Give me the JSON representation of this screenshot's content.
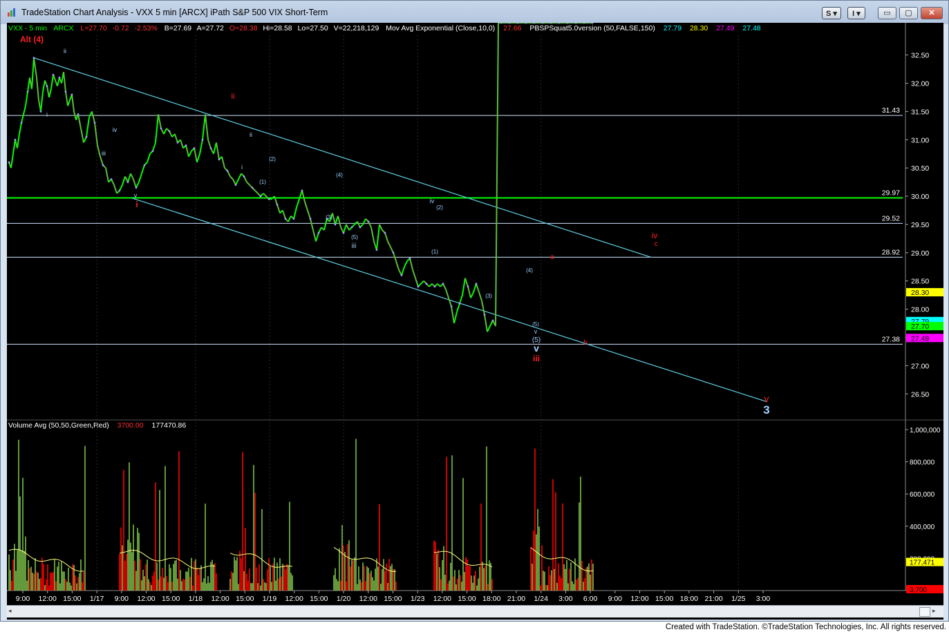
{
  "window": {
    "title": "TradeStation Chart Analysis - VXX 5 min [ARCX] iPath S&P 500 VIX Short-Term",
    "buttons": {
      "s_label": "S",
      "i_label": "I",
      "min": "▭",
      "max": "▢",
      "close": "✕"
    }
  },
  "header": {
    "symbol": "VXX - 5 min",
    "exchange": "ARCX",
    "last": "L=27.70",
    "change": "-0.72",
    "pct": "-2.53%",
    "bid": "B=27.69",
    "ask": "A=27.72",
    "open": "O=28.38",
    "hi": "Hi=28.58",
    "lo": "Lo=27.50",
    "vol": "V=22,218,129",
    "ma_label": "Mov Avg Exponential (Close,10,0)",
    "ma_val": "27.66",
    "pbs_label": "PBSPSquat5.0version (50,FALSE,150)",
    "pbs_v1": "27.79",
    "pbs_v2": "28.30",
    "pbs_v3": "27.49",
    "pbs_v4": "27.48"
  },
  "volume_header": {
    "label": "Volume Avg (50,50,Green,Red)",
    "v1": "3700.00",
    "v2": "177470.86"
  },
  "footer_text": "Created with TradeStation. ©TradeStation Technologies, Inc. All rights reserved.",
  "colors": {
    "up": "#00ff00",
    "down": "#ff0000",
    "channel": "#5fd3e6",
    "hline": "#cfe6ff",
    "green_line": "#00ff00",
    "wave_red": "#ff2020",
    "wave_blue": "#9fd3ff",
    "yellow_avg": "#ffff80"
  },
  "chart_data": [
    {
      "type": "line",
      "name_label": "VXX 5 min price (approximate path)",
      "x_ticks": [
        "9:00",
        "12:00",
        "15:00",
        "1/17",
        "9:00",
        "12:00",
        "15:00",
        "1/18",
        "12:00",
        "15:00",
        "1/19",
        "12:00",
        "15:00",
        "1/20",
        "12:00",
        "15:00",
        "1/23",
        "12:00",
        "15:00",
        "18:00",
        "21:00",
        "1/24",
        "3:00",
        "6:00",
        "9:00",
        "12:00",
        "15:00",
        "18:00",
        "21:00",
        "1/25",
        "3:00"
      ],
      "y_ticks": [
        "32.50",
        "32.00",
        "31.50",
        "31.00",
        "30.50",
        "30.00",
        "29.50",
        "29.00",
        "28.50",
        "28.00",
        "27.50",
        "27.00",
        "26.50"
      ],
      "ylim": [
        26.1,
        32.85
      ],
      "series_x": [
        0,
        3,
        6,
        9,
        12,
        15,
        18,
        21,
        24,
        27,
        30,
        33,
        36,
        40,
        43,
        46,
        49,
        52,
        55,
        58,
        61,
        64,
        67,
        70,
        73,
        76,
        79,
        82,
        85,
        88,
        91,
        94,
        97,
        100,
        104,
        108,
        112,
        116,
        120,
        124,
        128,
        132,
        136,
        140,
        144,
        148,
        152,
        156,
        160,
        164,
        168,
        172,
        176,
        180,
        184,
        188,
        192,
        196,
        200,
        204,
        208,
        212,
        216,
        220,
        224,
        228,
        232,
        236,
        240,
        244,
        248,
        252,
        256,
        260,
        264,
        268,
        272,
        276,
        280,
        284,
        288,
        292,
        296,
        300,
        304,
        308,
        312,
        316,
        320,
        324,
        328,
        332,
        336,
        340,
        344,
        348,
        352,
        356,
        360,
        364,
        368,
        372,
        376,
        380,
        384,
        388,
        392,
        396,
        400,
        404,
        408,
        412,
        416,
        420,
        424,
        428,
        432,
        436,
        440,
        444,
        448,
        452,
        456,
        460,
        464,
        468,
        472,
        476,
        480,
        484,
        488,
        492,
        496,
        500,
        504,
        508,
        512,
        516,
        520,
        524,
        528,
        532,
        536,
        540,
        544,
        548,
        552,
        556,
        560,
        564,
        568,
        572,
        576,
        580,
        584,
        588,
        592,
        596,
        600,
        604,
        608,
        612,
        616,
        620,
        624,
        628,
        632,
        636,
        640,
        644,
        648,
        652,
        656,
        660,
        664,
        668,
        672,
        676,
        680,
        684,
        688,
        692,
        696,
        700,
        704,
        708,
        712,
        716,
        720,
        724,
        728,
        732,
        736,
        740,
        744,
        748,
        752,
        756,
        760,
        764,
        768,
        772,
        776,
        780,
        784,
        788,
        792,
        796,
        800,
        804,
        808,
        812,
        816,
        820,
        824,
        828,
        832,
        836,
        840,
        844
      ],
      "series_y": [
        30.6,
        30.5,
        30.75,
        31.0,
        30.85,
        31.1,
        31.3,
        31.45,
        31.6,
        31.85,
        32.1,
        31.9,
        32.45,
        32.1,
        31.7,
        31.5,
        31.85,
        32.05,
        31.95,
        31.75,
        31.9,
        32.15,
        32.05,
        31.95,
        32.1,
        32.0,
        32.2,
        31.85,
        31.6,
        31.7,
        31.8,
        31.5,
        31.35,
        31.45,
        31.2,
        30.95,
        31.05,
        31.4,
        31.5,
        31.3,
        30.9,
        30.7,
        30.55,
        30.5,
        30.25,
        30.3,
        30.2,
        30.05,
        30.1,
        30.2,
        30.35,
        30.25,
        30.4,
        30.3,
        30.15,
        30.25,
        30.4,
        30.55,
        30.6,
        30.75,
        30.8,
        30.95,
        31.45,
        31.2,
        31.1,
        31.2,
        31.15,
        31.05,
        31.1,
        30.95,
        31.0,
        30.85,
        30.9,
        30.7,
        30.8,
        30.85,
        30.6,
        30.75,
        31.0,
        31.45,
        31.0,
        30.85,
        30.75,
        30.95,
        30.65,
        30.7,
        30.5,
        30.45,
        30.35,
        30.3,
        30.2,
        30.3,
        30.4,
        30.35,
        30.25,
        30.2,
        30.15,
        30.1,
        30.05,
        30.0,
        30.05,
        30.0,
        29.95,
        29.95,
        30.0,
        29.85,
        29.7,
        29.75,
        29.6,
        29.55,
        29.65,
        29.6,
        29.8,
        29.95,
        30.1,
        29.9,
        29.75,
        29.6,
        29.4,
        29.2,
        29.35,
        29.45,
        29.4,
        29.6,
        29.55,
        29.7,
        29.5,
        29.65,
        29.45,
        29.35,
        29.5,
        29.4,
        29.45,
        29.5,
        29.55,
        29.45,
        29.5,
        29.6,
        29.55,
        29.45,
        29.2,
        29.05,
        29.5,
        29.4,
        29.35,
        29.2,
        29.1,
        29.0,
        28.85,
        28.7,
        28.6,
        28.75,
        28.85,
        28.9,
        28.7,
        28.55,
        28.4,
        28.45,
        28.5,
        28.45,
        28.4,
        28.45,
        28.4,
        28.45,
        28.4,
        28.45,
        28.35,
        28.2,
        28.05,
        27.75,
        27.95,
        28.1,
        28.25,
        28.55,
        28.4,
        28.2,
        28.3,
        28.45,
        28.3,
        28.15,
        27.9,
        27.6,
        27.7,
        27.8,
        27.7
      ]
    },
    {
      "type": "bar",
      "name_label": "Volume",
      "y_ticks": [
        "1,000,000",
        "800,000",
        "600,000",
        "400,000",
        "200,000"
      ],
      "ylim": [
        0,
        1030000
      ],
      "markers": [
        {
          "label": "177,471",
          "value": 177471
        },
        {
          "label": "3,700",
          "value": 3700
        }
      ]
    }
  ],
  "levels": [
    {
      "label": "31.43",
      "value": 31.43
    },
    {
      "label": "29.97",
      "value": 29.97,
      "green": true
    },
    {
      "label": "29.52",
      "value": 29.52
    },
    {
      "label": "28.92",
      "value": 28.92
    },
    {
      "label": "27.38",
      "value": 27.38
    }
  ],
  "axis_markers": [
    {
      "label": "28.30",
      "value": 28.3,
      "bg": "#ffff00",
      "fg": "#000"
    },
    {
      "label": "27.79",
      "value": 27.79,
      "bg": "#00ffff",
      "fg": "#000"
    },
    {
      "label": "27.70",
      "value": 27.7,
      "bg": "#00ff00",
      "fg": "#000"
    },
    {
      "label": "27.49",
      "value": 27.49,
      "bg": "#ff00ff",
      "fg": "#000"
    }
  ],
  "wave_labels": [
    {
      "t": "Alt (4)",
      "c": "red",
      "s": 12,
      "b": true
    },
    {
      "t": "ii",
      "c": "blue",
      "s": 9
    },
    {
      "t": "i",
      "c": "blue",
      "s": 9
    },
    {
      "t": "iii",
      "c": "blue",
      "s": 9
    },
    {
      "t": "iv",
      "c": "blue",
      "s": 9
    },
    {
      "t": "v",
      "c": "blue",
      "s": 9
    },
    {
      "t": "i",
      "c": "red",
      "s": 12,
      "b": true
    },
    {
      "t": "ii",
      "c": "red",
      "s": 12
    },
    {
      "t": "ii",
      "c": "blue",
      "s": 9
    },
    {
      "t": "i",
      "c": "blue",
      "s": 9
    },
    {
      "t": "(2)",
      "c": "blue",
      "s": 8
    },
    {
      "t": "(1)",
      "c": "blue",
      "s": 8
    },
    {
      "t": "(4)",
      "c": "blue",
      "s": 8
    },
    {
      "t": "(3)",
      "c": "blue",
      "s": 8
    },
    {
      "t": "(5)",
      "c": "blue",
      "s": 8
    },
    {
      "t": "iii",
      "c": "blue",
      "s": 10
    },
    {
      "t": "iv",
      "c": "blue",
      "s": 9
    },
    {
      "t": "(2)",
      "c": "blue",
      "s": 8
    },
    {
      "t": "(1)",
      "c": "blue",
      "s": 8
    },
    {
      "t": "(3)",
      "c": "blue",
      "s": 8
    },
    {
      "t": "(4)",
      "c": "blue",
      "s": 8
    },
    {
      "t": "(5)",
      "c": "blue",
      "s": 8
    },
    {
      "t": "v",
      "c": "blue",
      "s": 9
    },
    {
      "t": "(5)",
      "c": "blue",
      "s": 10
    },
    {
      "t": "v",
      "c": "blue",
      "s": 14,
      "b": true
    },
    {
      "t": "iii",
      "c": "red",
      "s": 12,
      "b": true
    },
    {
      "t": "a",
      "c": "red",
      "s": 10
    },
    {
      "t": "b",
      "c": "red",
      "s": 10
    },
    {
      "t": "iv",
      "c": "red",
      "s": 12
    },
    {
      "t": "c",
      "c": "red",
      "s": 10
    },
    {
      "t": "v",
      "c": "red",
      "s": 14
    },
    {
      "t": "3",
      "c": "blue",
      "s": 17,
      "b": true
    }
  ]
}
